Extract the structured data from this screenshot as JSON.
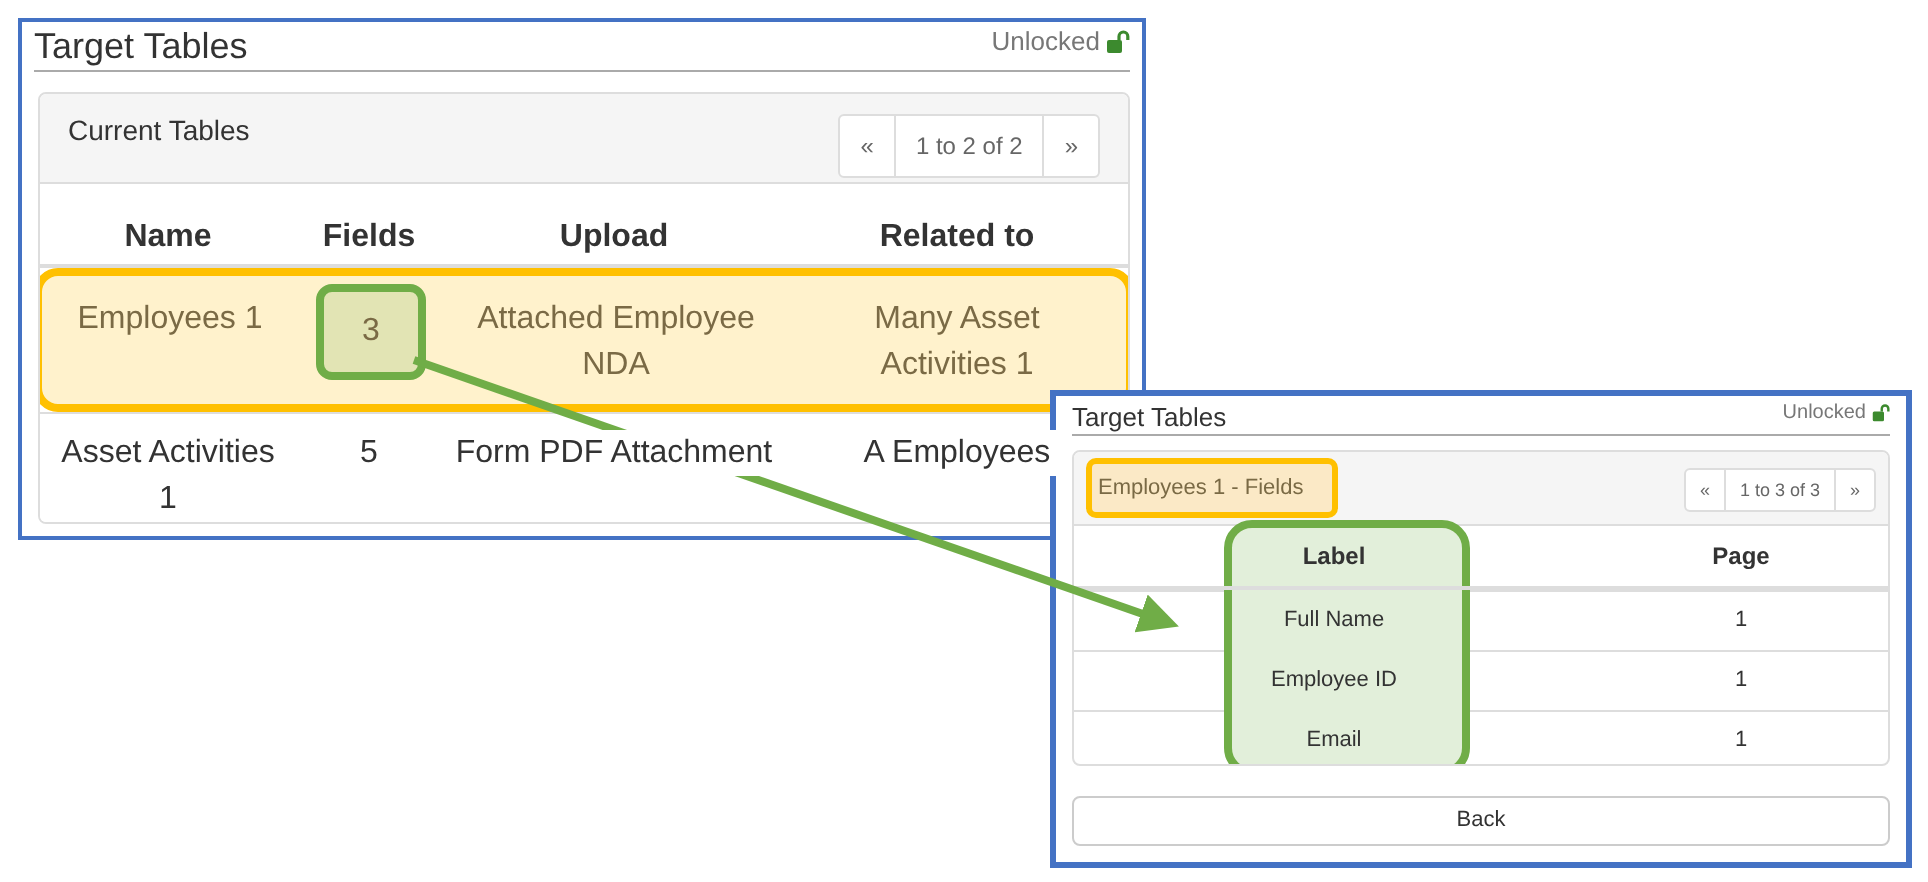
{
  "windows": [
    {
      "title": "Target Tables",
      "lock_label": "Unlocked",
      "panel": {
        "title": "Current Tables",
        "title_highlighted": false
      },
      "pager": {
        "prev": "«",
        "range": "1 to 2 of 2",
        "next": "»"
      },
      "columns": [
        "Name",
        "Fields",
        "Upload",
        "Related to"
      ],
      "rows": [
        {
          "highlighted": true,
          "cells": [
            {
              "text": "Employees 1",
              "highlighted": false
            },
            {
              "text": "3",
              "highlighted": true
            },
            {
              "text": "Attached Employee NDA",
              "highlighted": false
            },
            {
              "text": "Many Asset Activities 1",
              "highlighted": false
            }
          ]
        },
        {
          "highlighted": false,
          "cells": [
            {
              "text": "Asset Activities 1",
              "highlighted": false
            },
            {
              "text": "5",
              "highlighted": false
            },
            {
              "text": "Form PDF Attachment",
              "highlighted": false
            },
            {
              "text": "A Employees",
              "highlighted": false
            }
          ]
        }
      ]
    },
    {
      "title": "Target Tables",
      "lock_label": "Unlocked",
      "panel": {
        "title": "Employees 1 - Fields",
        "title_highlighted": true
      },
      "pager": {
        "prev": "«",
        "range": "1 to 3 of 3",
        "next": "»"
      },
      "columns": [
        {
          "label": "Label",
          "highlighted": true
        },
        {
          "label": "Page",
          "highlighted": false
        }
      ],
      "rows": [
        {
          "highlighted": false,
          "cells": [
            {
              "text": "Full Name",
              "highlighted": false
            },
            {
              "text": "1",
              "highlighted": false
            }
          ]
        },
        {
          "highlighted": false,
          "cells": [
            {
              "text": "Employee ID",
              "highlighted": false
            },
            {
              "text": "1",
              "highlighted": false
            }
          ]
        },
        {
          "highlighted": false,
          "cells": [
            {
              "text": "Email",
              "highlighted": false
            },
            {
              "text": "1",
              "highlighted": false
            }
          ]
        }
      ],
      "button": "Back"
    }
  ]
}
